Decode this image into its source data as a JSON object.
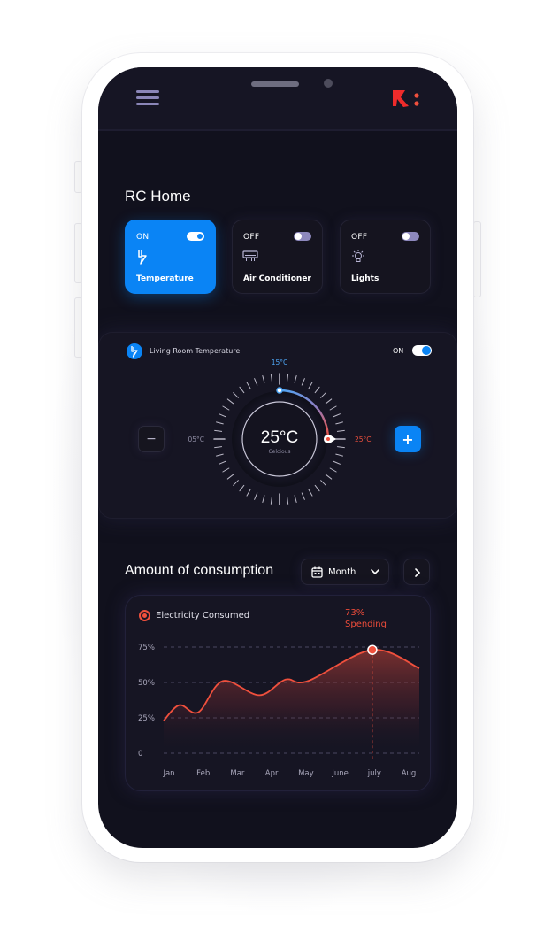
{
  "header": {
    "menu_icon": "hamburger-menu-icon",
    "logo": "R:"
  },
  "home": {
    "title": "RC Home",
    "devices": [
      {
        "state": "ON",
        "label": "Temperature",
        "icon": "lightning-icon",
        "active": true
      },
      {
        "state": "OFF",
        "label": "Air Conditioner",
        "icon": "air-conditioner-icon",
        "active": false
      },
      {
        "state": "OFF",
        "label": "Lights",
        "icon": "lightbulb-icon",
        "active": false
      }
    ]
  },
  "thermostat": {
    "title": "Living Room Temperature",
    "power_state": "ON",
    "current_value": "25°C",
    "unit_label": "Celcious",
    "min_label": "05°C",
    "top_label": "15°C",
    "target_label": "25°C",
    "decrease_label": "−",
    "increase_label": "+",
    "range_min": 5,
    "range_top": 15,
    "target": 25
  },
  "consumption": {
    "title": "Amount of consumption",
    "period_select": "Month",
    "next_icon": "chevron-right-icon"
  },
  "colors": {
    "accent_blue": "#0a84f5",
    "accent_red": "#f0503d",
    "background": "#11111d",
    "card": "#161523"
  },
  "chart_data": {
    "type": "area",
    "title": "Electricity Consumed",
    "annotation": {
      "value": "73%",
      "label": "Spending",
      "category": "july"
    },
    "categories": [
      "Jan",
      "Feb",
      "Mar",
      "Apr",
      "May",
      "June",
      "july",
      "Aug"
    ],
    "y_ticks": [
      "0",
      "25%",
      "50%",
      "75%"
    ],
    "ylim": [
      0,
      75
    ],
    "grid": true,
    "legend": "top-left",
    "series": [
      {
        "name": "Electricity Consumed",
        "points": [
          {
            "x": 0.0,
            "y": 23
          },
          {
            "x": 0.45,
            "y": 34
          },
          {
            "x": 1.0,
            "y": 29
          },
          {
            "x": 1.7,
            "y": 51
          },
          {
            "x": 2.75,
            "y": 41
          },
          {
            "x": 3.5,
            "y": 52
          },
          {
            "x": 4.15,
            "y": 51
          },
          {
            "x": 6.0,
            "y": 73
          },
          {
            "x": 7.35,
            "y": 60
          }
        ]
      }
    ]
  }
}
